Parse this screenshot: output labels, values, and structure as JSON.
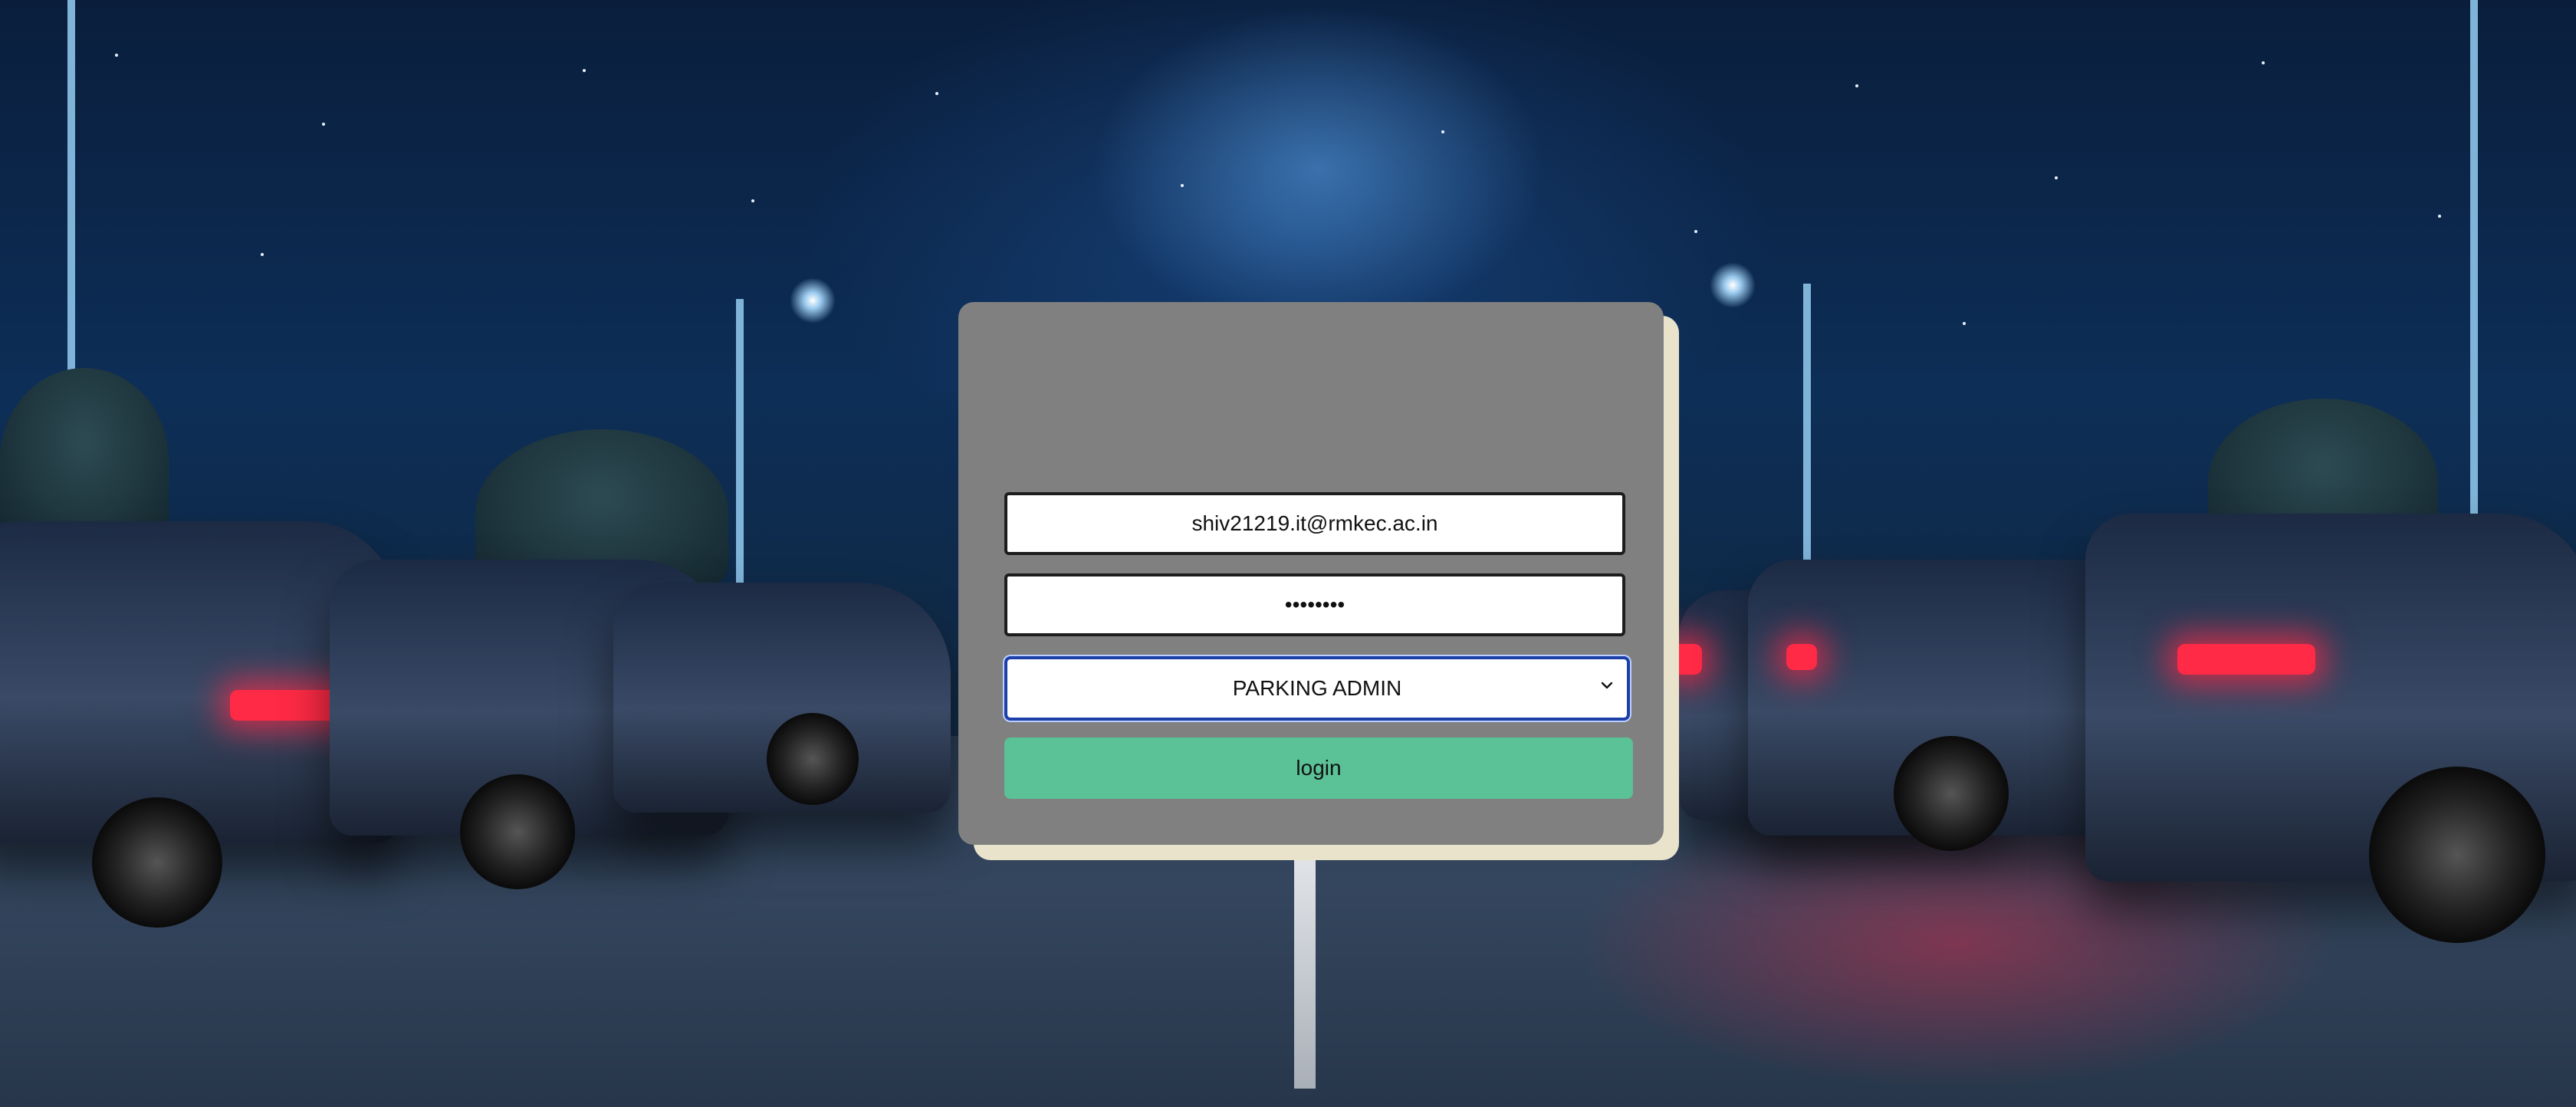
{
  "form": {
    "email_value": "shiv21219.it@rmkec.ac.in",
    "password_value": "••••••••",
    "role_options": [
      "PARKING ADMIN"
    ],
    "role_selected": "PARKING ADMIN",
    "login_label": "login"
  },
  "colors": {
    "panel": "#808080",
    "panel_shadow": "#e9e3cc",
    "login_button": "#5bc297",
    "select_focus_border": "#1c3fa8"
  },
  "icons": {
    "select_arrow": "chevron-down-icon"
  }
}
